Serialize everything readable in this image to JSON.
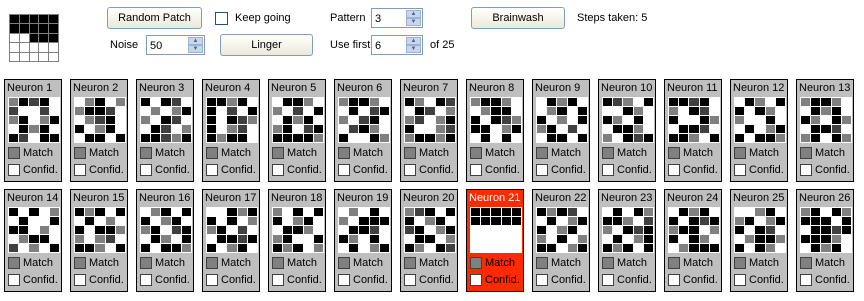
{
  "colors": {
    "black": "#000000",
    "dark": "#404040",
    "mid": "#808080",
    "light": "#c0c0c0",
    "white": "#ffffff",
    "highlight": "#ff2a00"
  },
  "pattern_preview": [
    "00000",
    "00000",
    "ww000",
    "wwwww",
    "wwwww"
  ],
  "controls": {
    "random_patch_label": "Random Patch",
    "keep_going_label": "Keep going",
    "pattern_label": "Pattern",
    "pattern_value": "3",
    "brainwash_label": "Brainwash",
    "steps_text": "Steps taken: 5",
    "noise_label": "Noise",
    "noise_value": "50",
    "linger_label": "Linger",
    "use_first_label": "Use first",
    "use_first_value": "6",
    "of_total_text": "of 25"
  },
  "neuron_labels": {
    "match": "Match",
    "confid": "Confid."
  },
  "neurons": [
    {
      "name": "Neuron 1",
      "grid": [
        "mk0kw",
        "0ww0w",
        "mkwmk",
        "wkmkw",
        "k0wkk"
      ]
    },
    {
      "name": "Neuron 2",
      "grid": [
        "wmkwm",
        "mkk0w",
        "wm0kw",
        "kwmkw",
        "wkkwk"
      ]
    },
    {
      "name": "Neuron 3",
      "grid": [
        "kwk0w",
        "wmwmk",
        "mwk0w",
        "wk0wm",
        "kk0mk"
      ]
    },
    {
      "name": "Neuron 4",
      "grid": [
        "kkmkw",
        "kw0wk",
        "kwk0m",
        "kwm0w",
        "kmkkw"
      ]
    },
    {
      "name": "Neuron 5",
      "grid": [
        "wkkmw",
        "mw0wk",
        "wkmkw",
        "mkw0k",
        "kkkkm"
      ]
    },
    {
      "name": "Neuron 6",
      "grid": [
        "mkkmw",
        "wkw0k",
        "mw0kw",
        "w0kmw",
        "kwwkm"
      ]
    },
    {
      "name": "Neuron 7",
      "grid": [
        "kmwk0",
        "wk0wm",
        "m0wmk",
        "kwwm0",
        "mkkmk"
      ]
    },
    {
      "name": "Neuron 8",
      "grid": [
        "mkkmw",
        "wmkkw",
        "kwk0m",
        "kkwmk",
        "wkwkw"
      ]
    },
    {
      "name": "Neuron 9",
      "grid": [
        "wkmkw",
        "wmkwk",
        "kwmwk",
        "mkw0w",
        "wkkwk"
      ]
    },
    {
      "name": "Neuron 10",
      "grid": [
        "k0mwk",
        "wwkmw",
        "kmwkw",
        "wkkmw",
        "mwk0k"
      ]
    },
    {
      "name": "Neuron 11",
      "grid": [
        "kk0kw",
        "mwk0w",
        "kwwkm",
        "wkk0w",
        "kkmwk"
      ]
    },
    {
      "name": "Neuron 12",
      "grid": [
        "wkmwk",
        "kwkmw",
        "mwwkw",
        "wkwmk",
        "kwkkm"
      ]
    },
    {
      "name": "Neuron 13",
      "grid": [
        "mkkmw",
        "wkmkw",
        "kmwkm",
        "wkk0w",
        "mkwkm"
      ]
    },
    {
      "name": "Neuron 14",
      "grid": [
        "kwkwm",
        "wkwwk",
        "kkwmw",
        "wmkkw",
        "0wmwk"
      ]
    },
    {
      "name": "Neuron 15",
      "grid": [
        "kmkwk",
        "wkwmw",
        "kwkkm",
        "mwm0w",
        "kkmwk"
      ]
    },
    {
      "name": "Neuron 16",
      "grid": [
        "wmkwk",
        "kwmkw",
        "mkw0k",
        "wkmwk",
        "kwkkm"
      ]
    },
    {
      "name": "Neuron 17",
      "grid": [
        "wwkmk",
        "kwkwm",
        "mkw0w",
        "wkk0k",
        "kwmkw"
      ]
    },
    {
      "name": "Neuron 18",
      "grid": [
        "mwkwk",
        "kwmkw",
        "wkkmw",
        "mkwwk",
        "kmkwm"
      ]
    },
    {
      "name": "Neuron 19",
      "grid": [
        "wmwkw",
        "mwkkk",
        "wkk0w",
        "kmwkw",
        "wkwmk"
      ]
    },
    {
      "name": "Neuron 20",
      "grid": [
        "m0kwk",
        "kwmkw",
        "0kwmk",
        "wkkwm",
        "kmwk0"
      ]
    },
    {
      "name": "Neuron 21",
      "grid": [
        "kkkkk",
        "kkkkk",
        "wwwww",
        "wwwww",
        "wwwww"
      ]
    },
    {
      "name": "Neuron 22",
      "grid": [
        "kmk0w",
        "wkwmk",
        "kwmkw",
        "mwkwm",
        "kkwmk"
      ]
    },
    {
      "name": "Neuron 23",
      "grid": [
        "wkwkm",
        "kkmw0",
        "mwk0k",
        "wkwmk",
        "kmkwk"
      ]
    },
    {
      "name": "Neuron 24",
      "grid": [
        "wkmkw",
        "kwk0k",
        "mkkwm",
        "kwkmw",
        "wmkkk"
      ]
    },
    {
      "name": "Neuron 25",
      "grid": [
        "wwmkw",
        "mkwmk",
        "kwk0w",
        "wmkkm",
        "kwkmw"
      ]
    },
    {
      "name": "Neuron 26",
      "grid": [
        "mkwkm",
        "kkkwk",
        "wkk0k",
        "kkkmw",
        "wkmkw"
      ]
    }
  ]
}
